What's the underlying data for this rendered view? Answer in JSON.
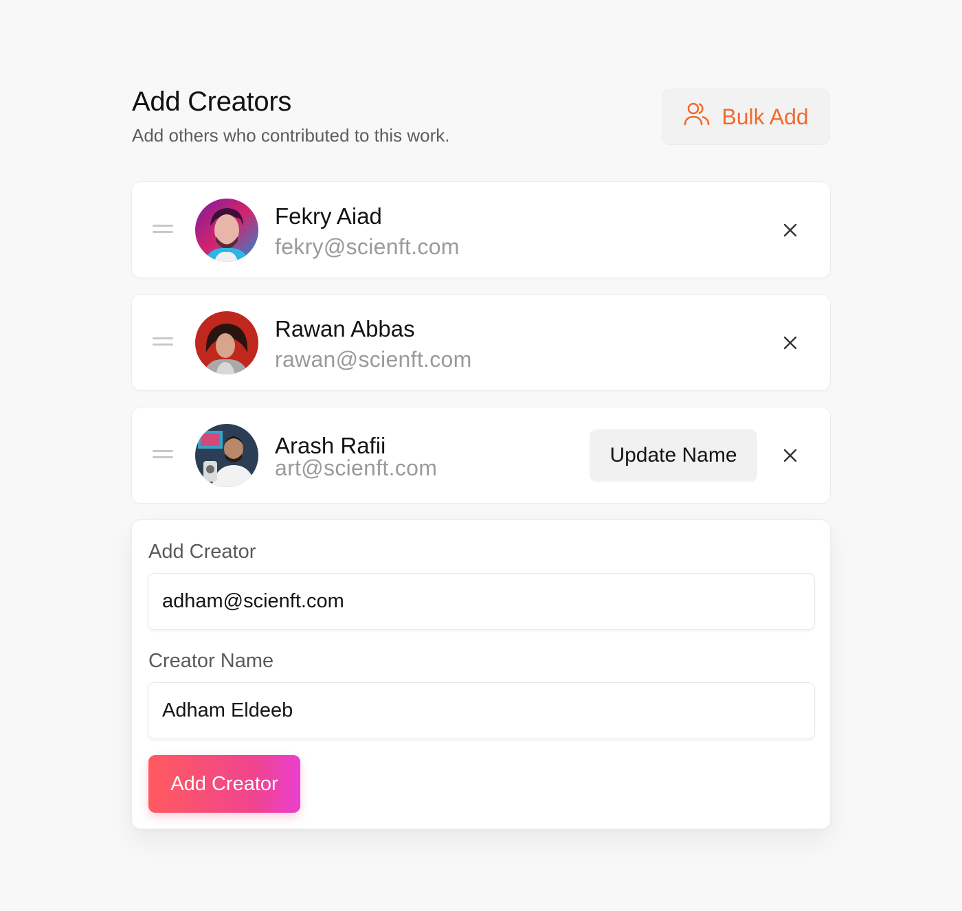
{
  "header": {
    "title": "Add Creators",
    "subtitle": "Add others who contributed to this work.",
    "bulk_add_label": "Bulk Add"
  },
  "creators": [
    {
      "name": "Fekry Aiad",
      "email": "fekry@scienft.com",
      "avatar_icon": "avatar-fekry"
    },
    {
      "name": "Rawan Abbas",
      "email": "rawan@scienft.com",
      "avatar_icon": "avatar-rawan"
    },
    {
      "name": "Arash Rafii",
      "email": "art@scienft.com",
      "avatar_icon": "avatar-arash",
      "update_name_label": "Update Name"
    }
  ],
  "add_form": {
    "email_label": "Add Creator",
    "email_value": "adham@scienft.com",
    "name_label": "Creator Name",
    "name_value": "Adham Eldeeb",
    "submit_label": "Add Creator"
  },
  "colors": {
    "accent": "#f06a2c",
    "gradient_start": "#ff5a5f",
    "gradient_end": "#ea3fcf"
  },
  "icons": {
    "bulk_add": "users-icon",
    "remove": "close-icon",
    "drag": "drag-handle-icon"
  }
}
